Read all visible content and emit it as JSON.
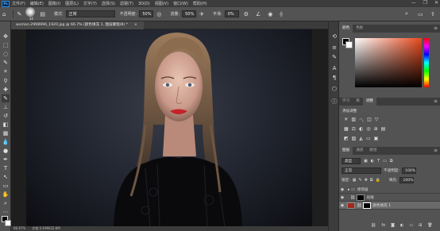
{
  "menubar": {
    "logo": "Ps",
    "items": [
      "文件(F)",
      "编辑(E)",
      "图像(I)",
      "图层(L)",
      "文字(Y)",
      "选择(S)",
      "滤镜(T)",
      "3D(D)",
      "视图(V)",
      "窗口(W)",
      "帮助(H)"
    ],
    "window_controls": [
      "—",
      "❐",
      "✕"
    ]
  },
  "options": {
    "brush_size": "32",
    "mode_label": "模式:",
    "mode_value": "正常",
    "opacity_label": "不透明度:",
    "opacity_value": "50%",
    "flow_label": "流量:",
    "flow_value": "50%",
    "smooth_label": "平滑:",
    "smooth_value": "0%"
  },
  "document": {
    "tab_title": "woman-2998996_1920.jpg @ 66.7% (颜色填充 1, 图层蒙版/8) *",
    "close": "×",
    "status_zoom": "66.67%",
    "status_doc": "文档:5.93M/22.6M"
  },
  "color_panel": {
    "tabs": [
      "颜色",
      "色板"
    ],
    "active": 0
  },
  "adjust_panel": {
    "tabs": [
      "学习",
      "库",
      "调整"
    ],
    "active": 2,
    "title": "添加调整"
  },
  "layers_panel": {
    "tabs": [
      "图层",
      "通道",
      "路径"
    ],
    "active": 0,
    "kind_label": "类型",
    "blend": "正常",
    "opacity_label": "不透明度:",
    "opacity_value": "100%",
    "lock_label": "锁定:",
    "fill_label": "填充:",
    "fill_value": "100%",
    "layers": [
      {
        "name": "修饰层",
        "type": "group"
      },
      {
        "name": "光线",
        "type": "layer"
      },
      {
        "name": "颜色填充 1",
        "type": "fill"
      }
    ]
  },
  "colors": {
    "fg": "#000000",
    "bg": "#ffffff",
    "fill_swatch": "#a0281e",
    "accent": "#2f8ae0"
  }
}
